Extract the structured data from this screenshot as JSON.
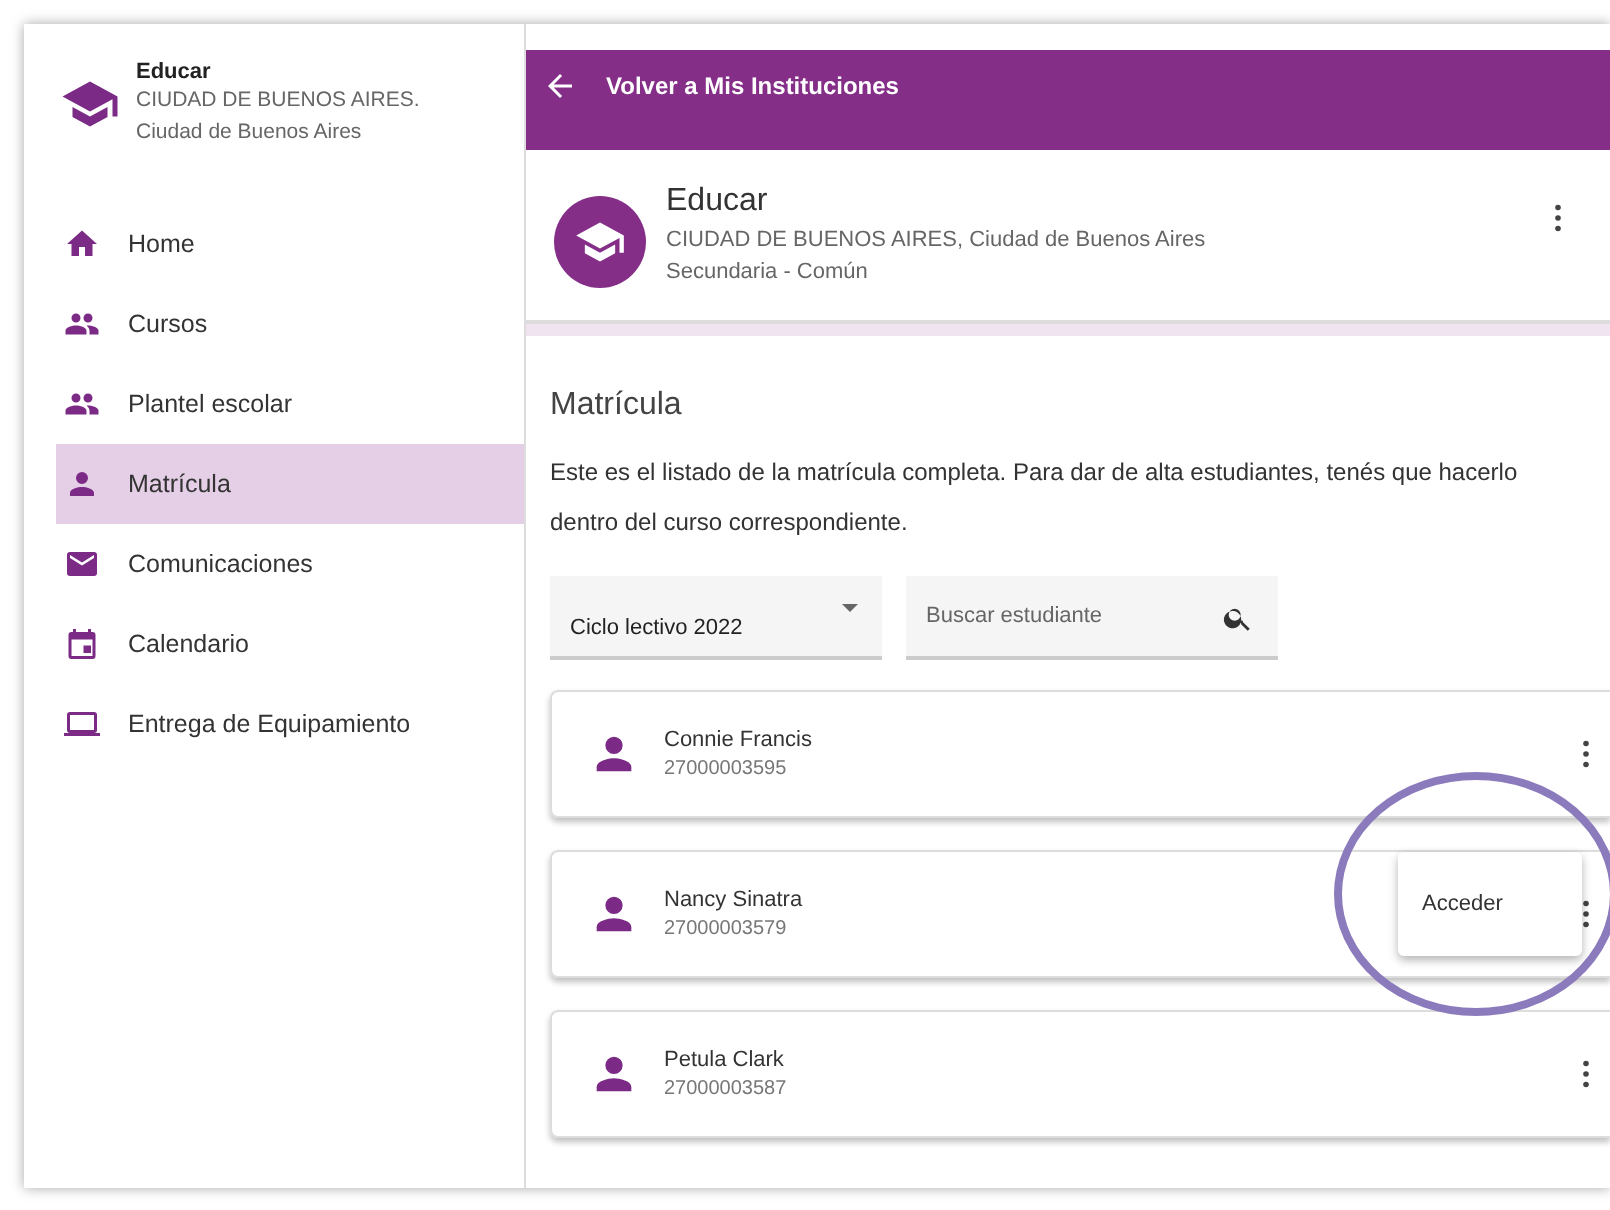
{
  "sidebar": {
    "org": {
      "name": "Educar",
      "location_line_1": "CIUDAD DE BUENOS AIRES.",
      "location_line_2": "Ciudad de Buenos Aires"
    },
    "items": [
      {
        "label": "Home",
        "kind": "home",
        "selected": false
      },
      {
        "label": "Cursos",
        "kind": "group",
        "selected": false
      },
      {
        "label": "Plantel escolar",
        "kind": "group",
        "selected": false
      },
      {
        "label": "Matrícula",
        "kind": "person",
        "selected": true
      },
      {
        "label": "Comunicaciones",
        "kind": "mail",
        "selected": false
      },
      {
        "label": "Calendario",
        "kind": "calendar",
        "selected": false
      },
      {
        "label": "Entrega de Equipamiento",
        "kind": "laptop",
        "selected": false
      }
    ]
  },
  "top_bar": {
    "back_label": "Volver a Mis Instituciones"
  },
  "institution": {
    "name": "Educar",
    "location": "CIUDAD DE BUENOS AIRES, Ciudad de Buenos Aires",
    "level": "Secundaria - Común"
  },
  "section": {
    "title": "Matrícula",
    "description": "Este es el listado de la matrícula completa. Para dar de alta estudiantes, tenés que hacerlo dentro del curso correspondiente."
  },
  "filters": {
    "cycle": {
      "value": "Ciclo lectivo 2022"
    },
    "search": {
      "placeholder": "Buscar estudiante"
    }
  },
  "students": [
    {
      "name": "Connie Francis",
      "id": "27000003595"
    },
    {
      "name": "Nancy Sinatra",
      "id": "27000003579"
    },
    {
      "name": "Petula Clark",
      "id": "27000003587"
    }
  ],
  "context_menu": {
    "items": [
      "Acceder"
    ]
  }
}
